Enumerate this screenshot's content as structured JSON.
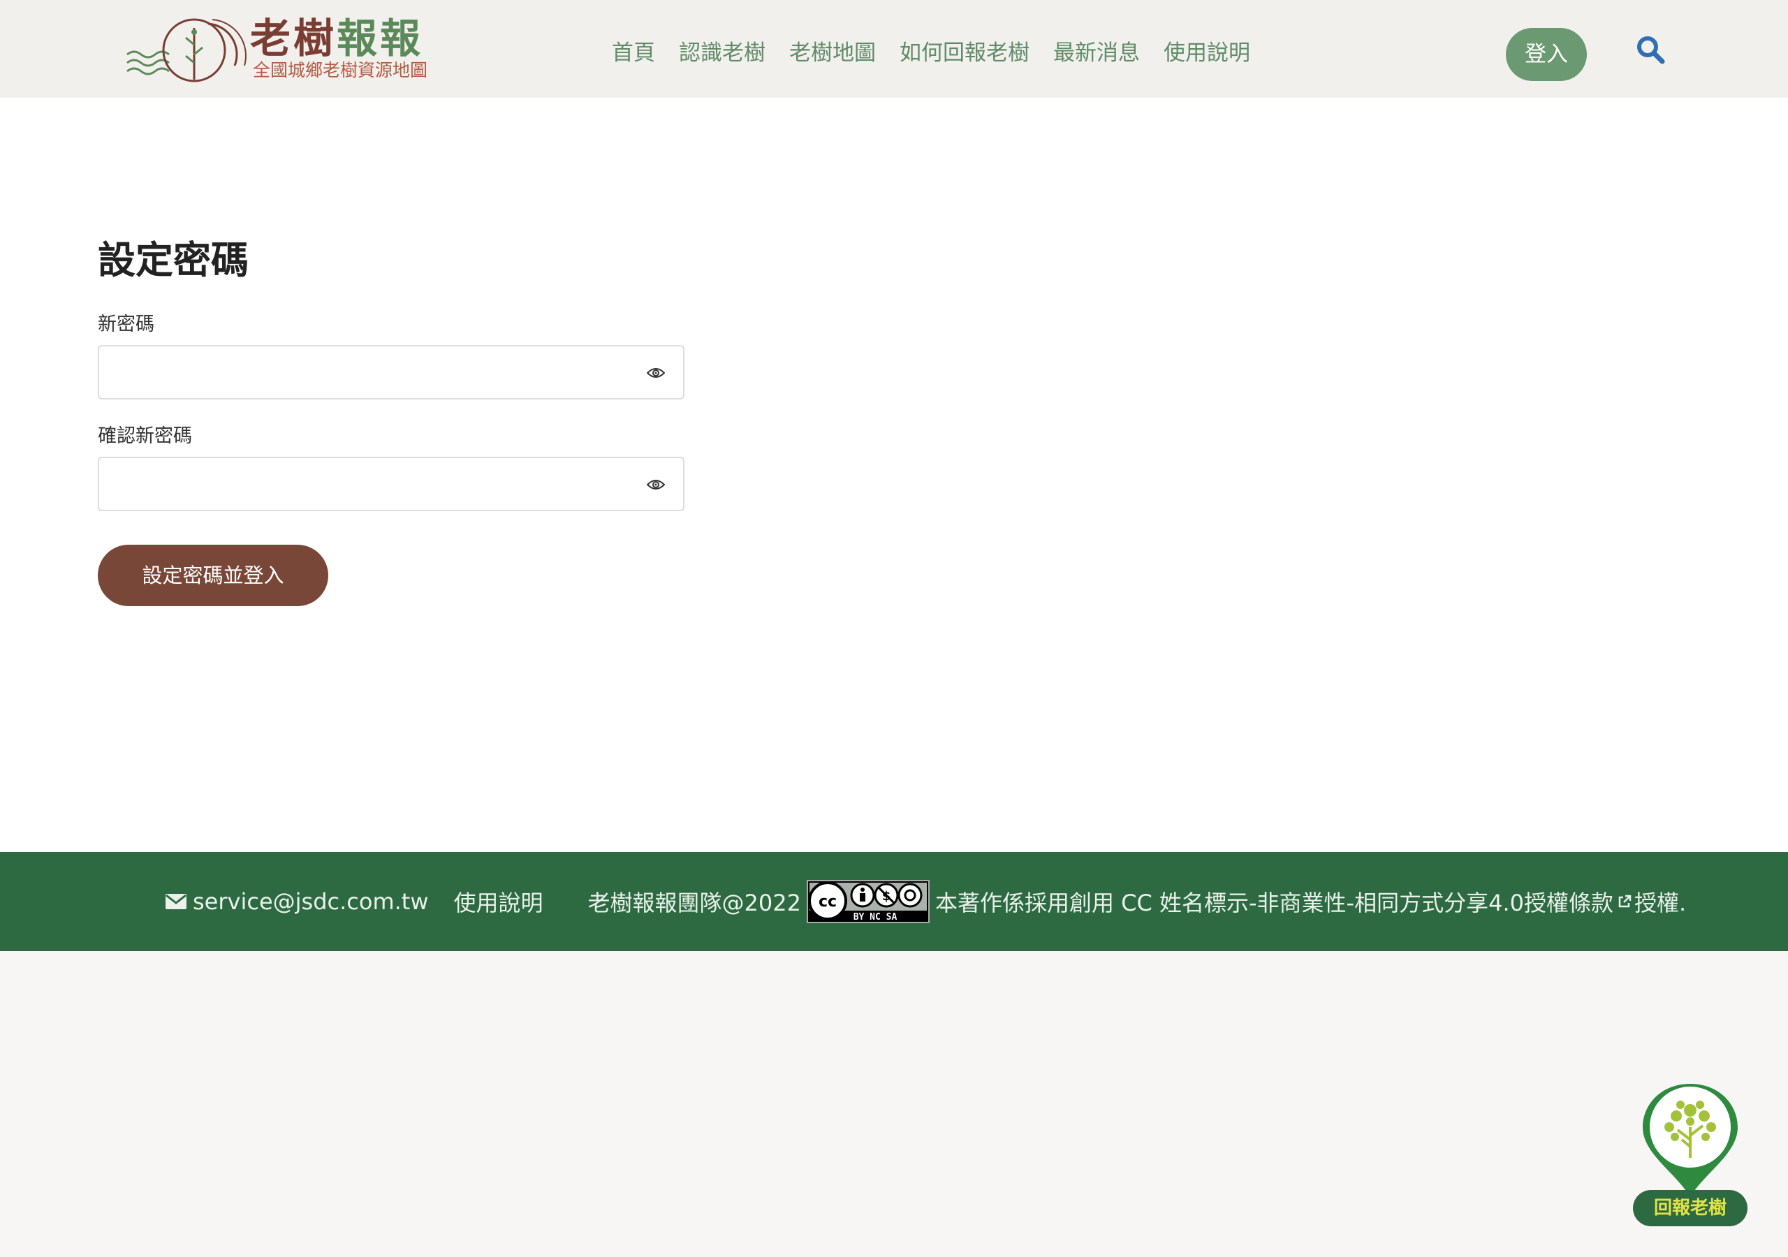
{
  "header": {
    "logo_title_part1": "老樹",
    "logo_title_part2": "報報",
    "logo_subtitle": "全國城鄉老樹資源地圖",
    "nav": [
      "首頁",
      "認識老樹",
      "老樹地圖",
      "如何回報老樹",
      "最新消息",
      "使用說明"
    ],
    "login_label": "登入",
    "search_icon": "search-icon"
  },
  "form": {
    "title": "設定密碼",
    "new_password_label": "新密碼",
    "new_password_value": "",
    "confirm_password_label": "確認新密碼",
    "confirm_password_value": "",
    "submit_label": "設定密碼並登入",
    "eye_icon": "eye-icon"
  },
  "footer": {
    "email": "service@jsdc.com.tw",
    "help_link": "使用說明",
    "copyright": "老樹報報團隊@2022",
    "cc_badge_text": "BY  NC  SA",
    "license_text": "本著作係採用創用 CC 姓名標示-非商業性-相同方式分享4.0授權條款",
    "license_suffix": "授權."
  },
  "report_badge": {
    "label": "回報老樹"
  },
  "colors": {
    "header_bg": "#f2f0ec",
    "nav_green": "#5f8b68",
    "login_green": "#6b9a72",
    "search_blue": "#2f6fb3",
    "submit_brown": "#784737",
    "footer_green": "#2d6a42",
    "badge_yellow": "#e2e24a"
  }
}
